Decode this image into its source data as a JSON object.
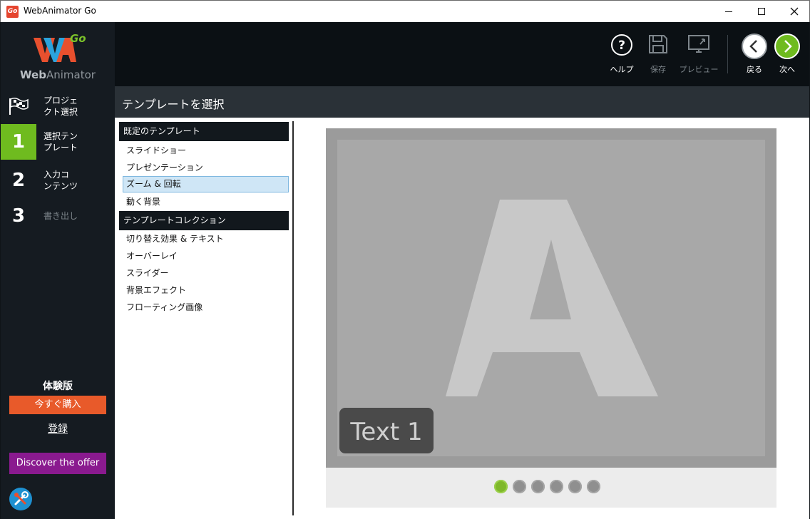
{
  "window": {
    "title": "WebAnimator Go",
    "app_icon_text": "Go"
  },
  "sidebar": {
    "logo": {
      "brand_a": "Web",
      "brand_b": "Animator",
      "badge": "Go"
    },
    "steps": [
      {
        "num": "",
        "label_line1": "プロジェ",
        "label_line2": "クト選択"
      },
      {
        "num": "1",
        "label_line1": "選択テン",
        "label_line2": "プレート"
      },
      {
        "num": "2",
        "label_line1": "入力コ",
        "label_line2": "ンテンツ"
      },
      {
        "num": "3",
        "label_line1": "書き出し",
        "label_line2": ""
      }
    ],
    "trial_label": "体験版",
    "buy_label": "今すぐ購入",
    "register_label": "登録",
    "offer_label": "Discover the offer"
  },
  "toolbar": {
    "help_label": "ヘルプ",
    "save_label": "保存",
    "preview_label": "プレビュー",
    "back_label": "戻る",
    "next_label": "次へ"
  },
  "header": {
    "title": "テンプレートを選択"
  },
  "templates": {
    "groups": [
      {
        "title": "既定のテンプレート",
        "items": [
          "スライドショー",
          "プレゼンテーション",
          "ズーム & 回転",
          "動く背景"
        ]
      },
      {
        "title": "テンプレートコレクション",
        "items": [
          "切り替え効果 & テキスト",
          "オーバーレイ",
          "スライダー",
          "背景エフェクト",
          "フローティング画像"
        ]
      }
    ],
    "selected": "ズーム & 回転"
  },
  "preview": {
    "big_letter": "A",
    "caption": "Text 1",
    "slides_total": 6,
    "slide_active": 1,
    "colors": {
      "accent_green": "#6fbb1f",
      "buy_orange": "#e85a2a",
      "offer_purple": "#8a1a8f"
    }
  }
}
